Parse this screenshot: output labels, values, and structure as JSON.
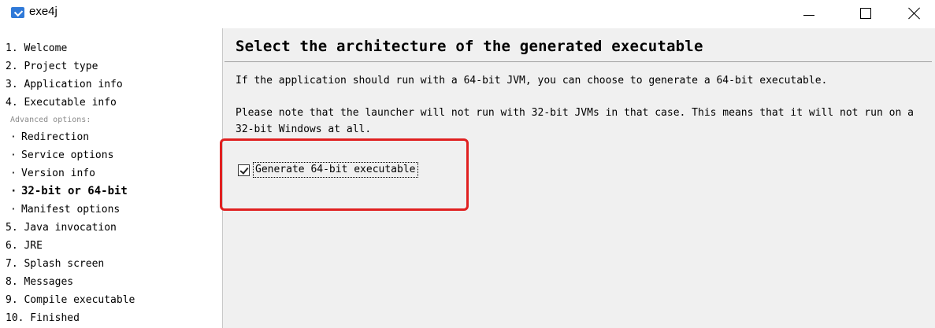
{
  "window": {
    "title": "exe4j",
    "icon": "exe4j-app-icon"
  },
  "sidebar": {
    "items": [
      {
        "label": "1. Welcome",
        "type": "step"
      },
      {
        "label": "2. Project type",
        "type": "step"
      },
      {
        "label": "3. Application info",
        "type": "step"
      },
      {
        "label": "4. Executable info",
        "type": "step"
      },
      {
        "label": "Advanced options:",
        "type": "subheader"
      },
      {
        "label": "Redirection",
        "type": "sub",
        "bullet": "·"
      },
      {
        "label": "Service options",
        "type": "sub",
        "bullet": "·"
      },
      {
        "label": "Version info",
        "type": "sub",
        "bullet": "·"
      },
      {
        "label": "32-bit or 64-bit",
        "type": "sub",
        "bullet": "·",
        "active": true
      },
      {
        "label": "Manifest options",
        "type": "sub",
        "bullet": "·"
      },
      {
        "label": "5. Java invocation",
        "type": "step"
      },
      {
        "label": "6. JRE",
        "type": "step"
      },
      {
        "label": "7. Splash screen",
        "type": "step"
      },
      {
        "label": "8. Messages",
        "type": "step"
      },
      {
        "label": "9. Compile executable",
        "type": "step"
      },
      {
        "label": "10. Finished",
        "type": "step"
      }
    ]
  },
  "main": {
    "heading": "Select the architecture of the generated executable",
    "paragraph1": "If the application should run with a 64-bit JVM, you can choose to generate a 64-bit executable.",
    "paragraph2": "Please note that the launcher will not run with 32-bit JVMs in that case. This means that it will not run on a 32-bit Windows at all.",
    "checkbox": {
      "label": "Generate 64-bit executable",
      "checked": true
    }
  },
  "colors": {
    "highlight": "#e02020",
    "panel_bg": "#f0f0f0",
    "app_icon": "#2f79d8"
  }
}
